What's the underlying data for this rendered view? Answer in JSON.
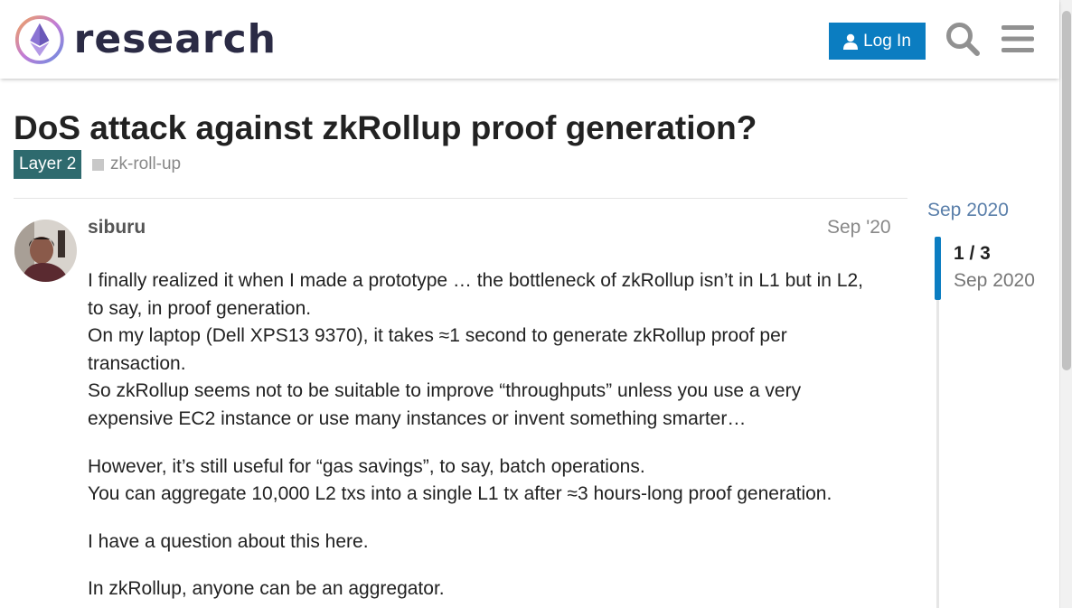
{
  "header": {
    "logo_text": "research",
    "login_label": "Log In",
    "search_icon": "search-icon",
    "menu_icon": "hamburger-menu-icon"
  },
  "topic": {
    "title": "DoS attack against zkRollup proof generation?",
    "category": "Layer 2",
    "tag": "zk-roll-up"
  },
  "post": {
    "username": "siburu",
    "date": "Sep '20",
    "paragraphs": [
      [
        "I finally realized it when I made a prototype … the bottleneck of zkRollup isn’t in L1 but in L2,",
        "to say, in proof generation.",
        "On my laptop (Dell XPS13 9370), it takes ≈1 second to generate zkRollup proof per",
        "transaction.",
        "So zkRollup seems not to be suitable to improve “throughputs” unless you use a very",
        "expensive EC2 instance or use many instances or invent something smarter…"
      ],
      [
        "However, it’s still useful for “gas savings”, to say, batch operations.",
        "You can aggregate 10,000 L2 txs into a single L1 tx after ≈3 hours-long proof generation."
      ],
      [
        "I have a question about this here."
      ],
      [
        "In zkRollup, anyone can be an aggregator."
      ]
    ]
  },
  "timeline": {
    "start_date": "Sep 2020",
    "count": "1 / 3",
    "current_date": "Sep 2020"
  },
  "colors": {
    "primary_blue": "#0b7dc1",
    "category_teal": "#2e6a6e",
    "timeline_link": "#5a7faa"
  }
}
